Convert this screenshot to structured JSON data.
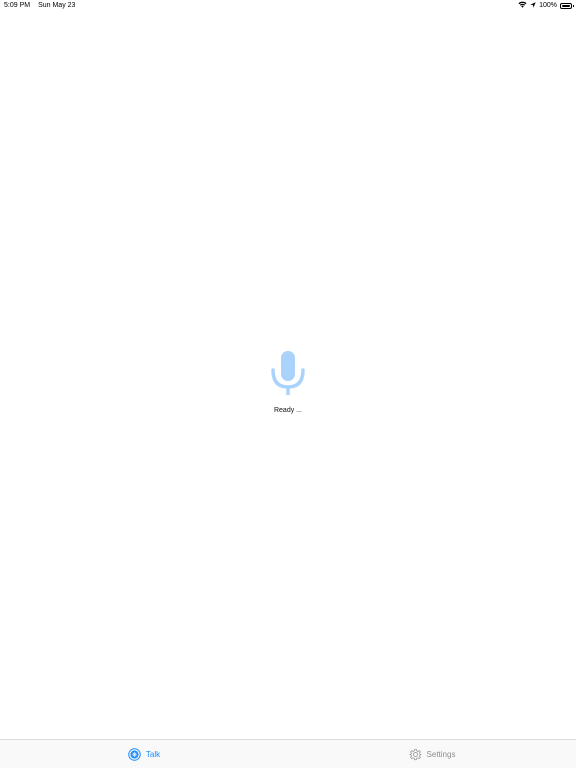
{
  "status_bar": {
    "time": "5:09 PM",
    "date": "Sun May 23",
    "battery_text": "100%",
    "battery_level": 1.0,
    "wifi_icon": "wifi-icon",
    "location_icon": "location-arrow-icon"
  },
  "main": {
    "mic_icon": "microphone-icon",
    "status_text": "Ready ..."
  },
  "tab_bar": {
    "tabs": [
      {
        "label": "Talk",
        "icon": "talk-icon",
        "selected": true
      },
      {
        "label": "Settings",
        "icon": "gear-icon",
        "selected": false
      }
    ]
  },
  "colors": {
    "accent": "#1a8cff",
    "mic": "#a9d3fb",
    "inactive": "#8e8e93"
  }
}
